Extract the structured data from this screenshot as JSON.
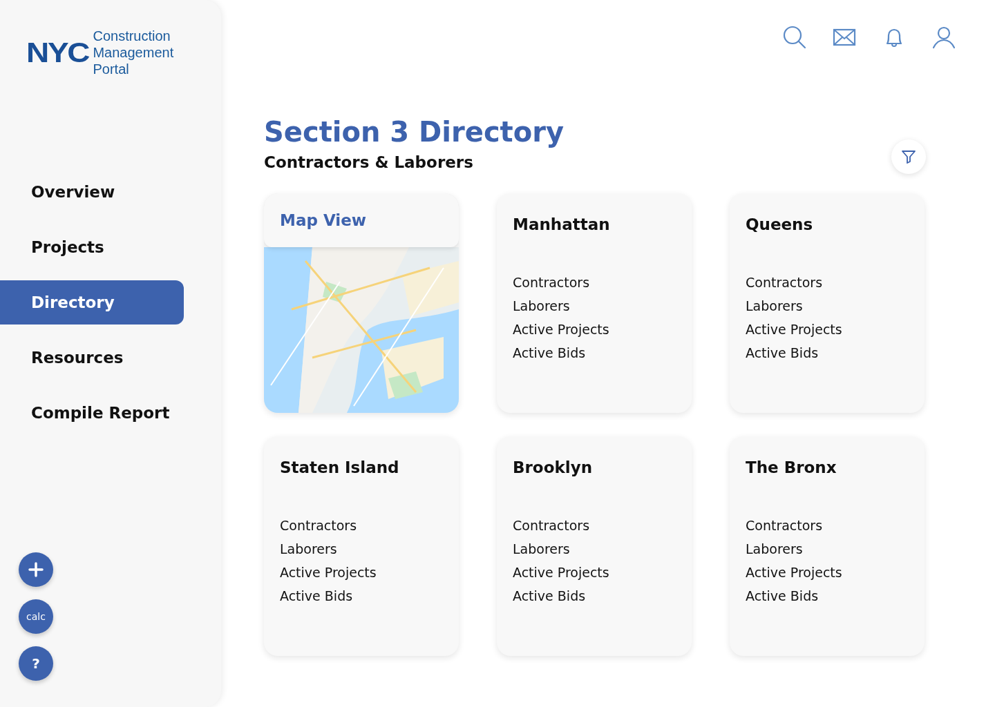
{
  "sidebar": {
    "logo": {
      "mark": "NYC",
      "title": [
        "Construction",
        "Management",
        "Portal"
      ]
    },
    "nav": [
      {
        "label": "Overview",
        "selected": false
      },
      {
        "label": "Projects",
        "selected": false
      },
      {
        "label": "Directory",
        "selected": true
      },
      {
        "label": "Resources",
        "selected": false
      },
      {
        "label": "Compile Report",
        "selected": false
      }
    ],
    "actions": [
      {
        "kind": "add"
      },
      {
        "kind": "text",
        "label": "calc"
      },
      {
        "kind": "text",
        "label": "?"
      }
    ]
  },
  "page": {
    "title": "Section 3 Directory",
    "subtitle": "Contractors & Laborers"
  },
  "cards": [
    {
      "kind": "map",
      "title": "Map View"
    },
    {
      "kind": "borough",
      "title": "Manhattan",
      "stats": [
        "Contractors",
        "Laborers",
        "Active Projects",
        "Active Bids"
      ]
    },
    {
      "kind": "borough",
      "title": "Queens",
      "stats": [
        "Contractors",
        "Laborers",
        "Active Projects",
        "Active Bids"
      ]
    },
    {
      "kind": "borough",
      "title": "Staten Island",
      "stats": [
        "Contractors",
        "Laborers",
        "Active Projects",
        "Active Bids"
      ]
    },
    {
      "kind": "borough",
      "title": "Brooklyn",
      "stats": [
        "Contractors",
        "Laborers",
        "Active Projects",
        "Active Bids"
      ]
    },
    {
      "kind": "borough",
      "title": "The Bronx",
      "stats": [
        "Contractors",
        "Laborers",
        "Active Projects",
        "Active Bids"
      ]
    }
  ]
}
